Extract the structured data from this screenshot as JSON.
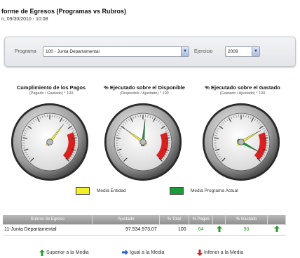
{
  "header": {
    "title": "forme de Egresos (Programas vs Rubros)",
    "subtitle": "n, 09/30/2010 - 10:08"
  },
  "filters": {
    "programa_label": "Programa",
    "programa_value": "100 - Junta Departamental",
    "ejercicio_label": "Ejercicio",
    "ejercicio_value": "2009"
  },
  "gauges": [
    {
      "title": "Cumplimiento de los Pagos",
      "subtitle": "(Pagado / Gastado) * 100",
      "needle_value": 64,
      "has_green_needle": false
    },
    {
      "title": "% Ejecutado sobre el Disponible",
      "subtitle": "(Disponible / Ajustado) * 100",
      "needle_value": 30,
      "has_green_needle": true
    },
    {
      "title": "% Ejecutado sobre el Gastado",
      "subtitle": "(Gastado / Ajustado) * 100",
      "needle_value": 72,
      "has_green_needle": true
    }
  ],
  "legend": {
    "media_entidad_label": "Media Entidad",
    "media_entidad_color": "#f2f026",
    "media_programa_label": "Media Programa Actual",
    "media_programa_color": "#1c9b3a"
  },
  "table": {
    "headers": [
      "Rubros de Egreso",
      "Ajustado",
      "% Total",
      "% Pagos",
      "% Gastado"
    ],
    "rows": [
      {
        "rubro": "11-Junta Departamental",
        "ajustado": "97.534.973,07",
        "total": "100",
        "pagos": "64",
        "gastado": "90"
      }
    ]
  },
  "footer": {
    "superior": "Superior a la Media",
    "igual": "Igual a la Media",
    "inferior": "Inferior a la Media"
  },
  "colors": {
    "green_arrow": "#2e9a2e",
    "blue_arrow": "#2a62c9",
    "red_arrow": "#d3201e",
    "red_zone": "#d82020"
  }
}
